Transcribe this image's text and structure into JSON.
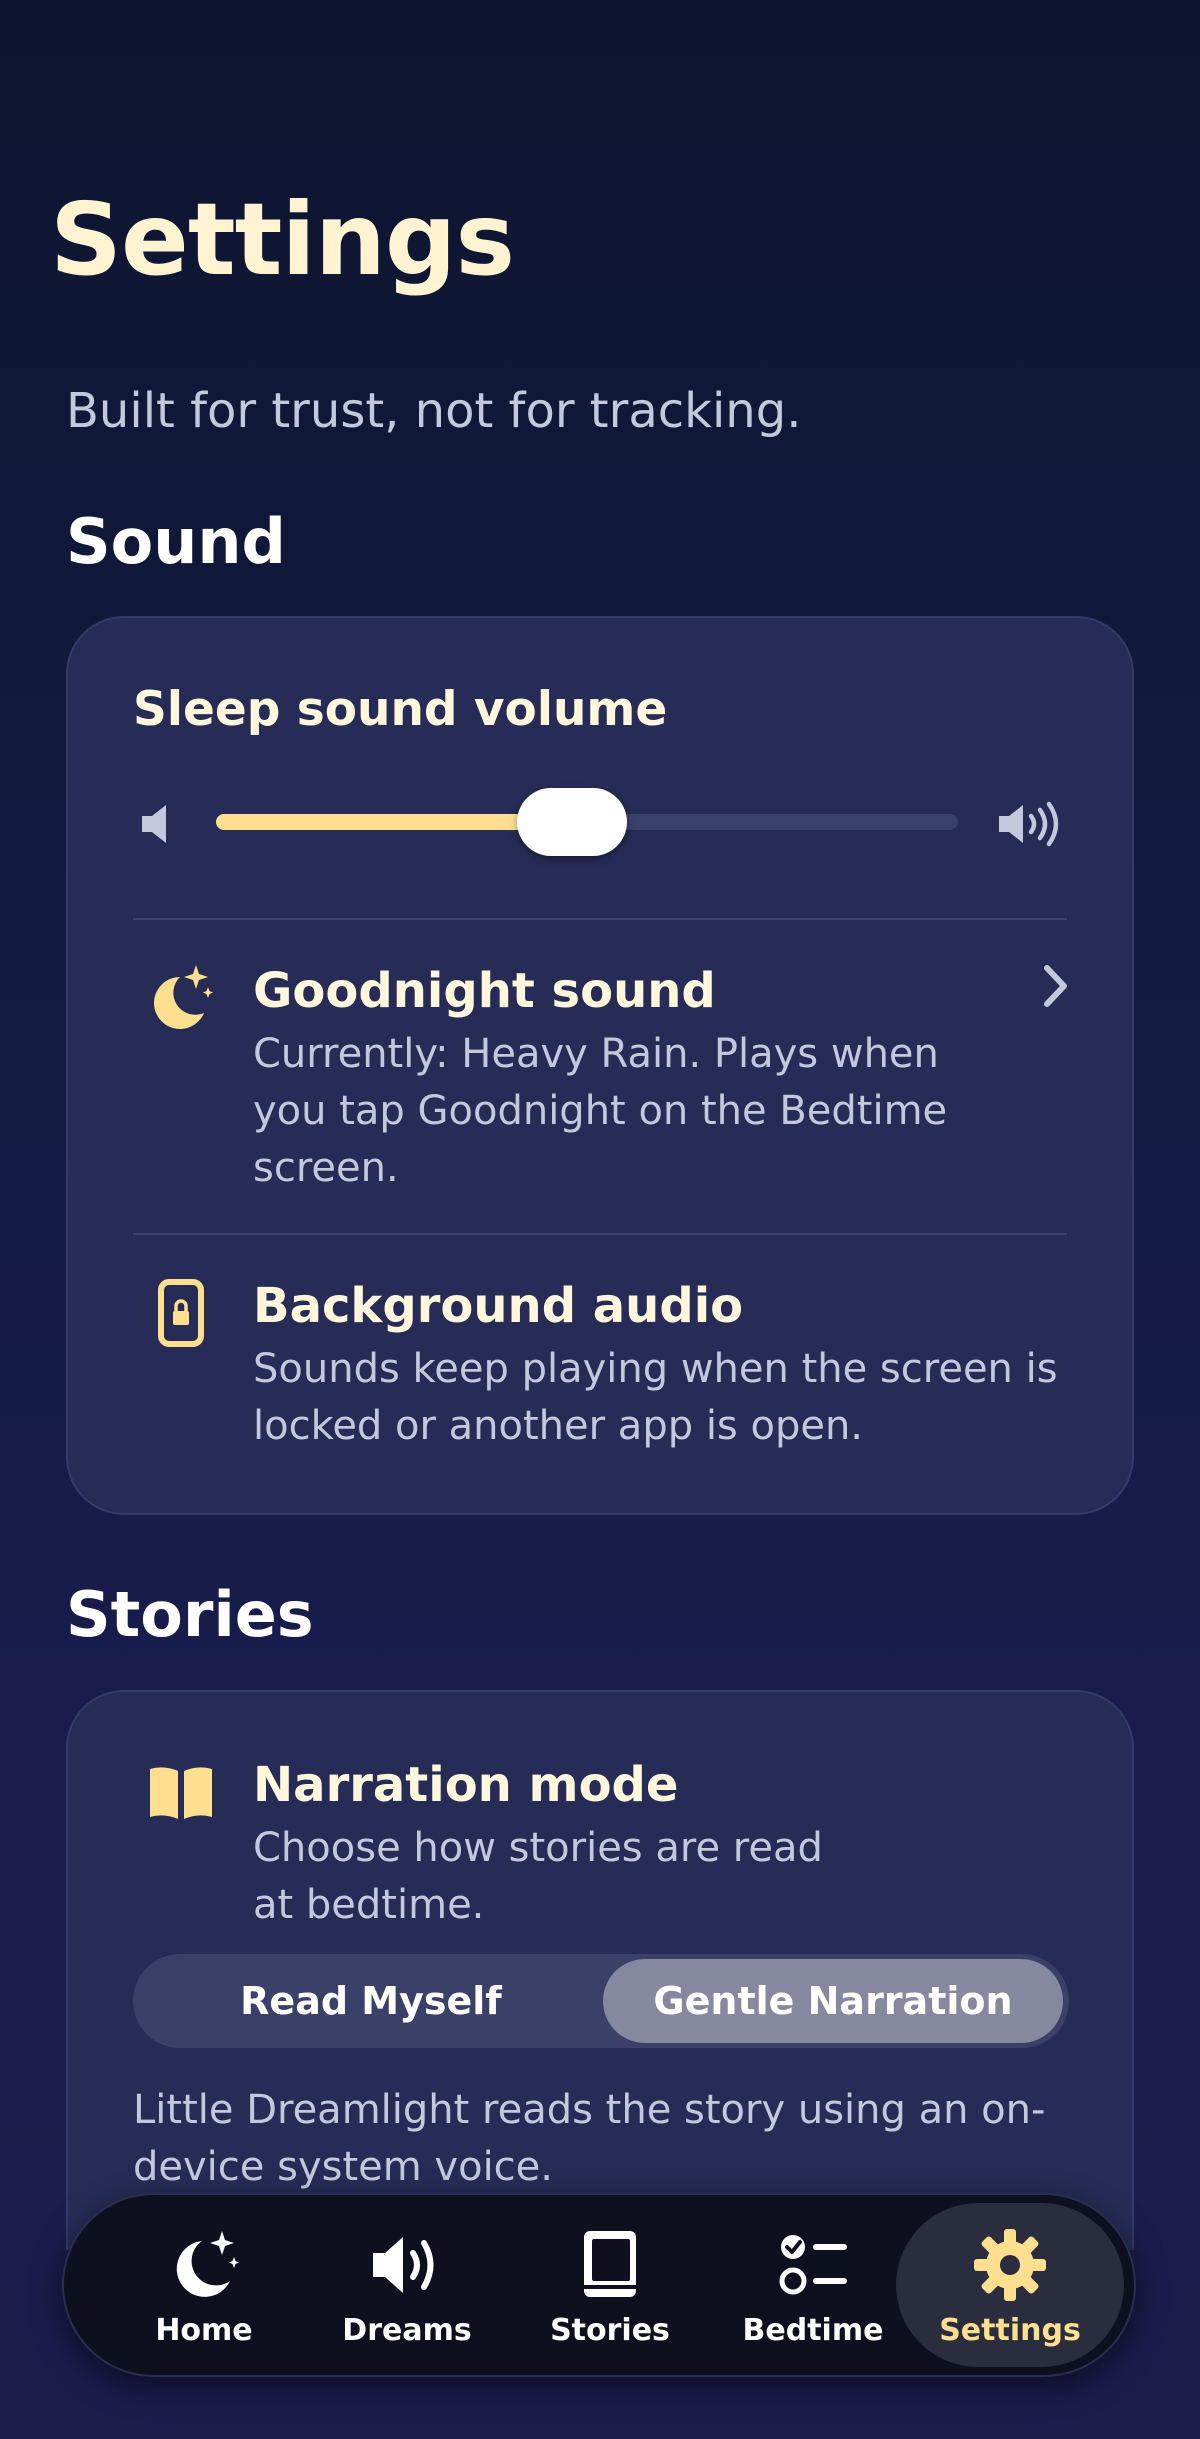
{
  "page": {
    "title": "Settings",
    "tagline": "Built for trust, not for tracking."
  },
  "sound": {
    "heading": "Sound",
    "volume": {
      "label": "Sleep sound volume",
      "value_percent": 48,
      "low_icon": "speaker-low-icon",
      "high_icon": "speaker-high-icon"
    },
    "goodnight": {
      "icon": "moon-sparkle-icon",
      "title": "Goodnight sound",
      "description": "Currently: Heavy Rain. Plays when you tap Goodnight on the Bedtime screen.",
      "chevron_icon": "chevron-right-icon"
    },
    "background": {
      "icon": "lock-phone-icon",
      "title": "Background audio",
      "description": "Sounds keep playing when the screen is locked or another app is open."
    }
  },
  "stories": {
    "heading": "Stories",
    "narration": {
      "icon": "open-book-icon",
      "title": "Narration mode",
      "description": "Choose how stories are read at bedtime.",
      "options": [
        "Read Myself",
        "Gentle Narration"
      ],
      "selected": "Gentle Narration",
      "note": "Little Dreamlight reads the story using an on-device system voice."
    }
  },
  "tabbar": {
    "items": [
      {
        "label": "Home",
        "icon": "moon-stars-icon"
      },
      {
        "label": "Dreams",
        "icon": "speaker-wave-icon"
      },
      {
        "label": "Stories",
        "icon": "book-icon"
      },
      {
        "label": "Bedtime",
        "icon": "checklist-icon"
      },
      {
        "label": "Settings",
        "icon": "gear-icon"
      }
    ],
    "active": "Settings"
  },
  "colors": {
    "accent": "#fddf8f",
    "card": "#262c55",
    "text_primary": "#fff6dc",
    "text_secondary": "#c2c9dc"
  }
}
